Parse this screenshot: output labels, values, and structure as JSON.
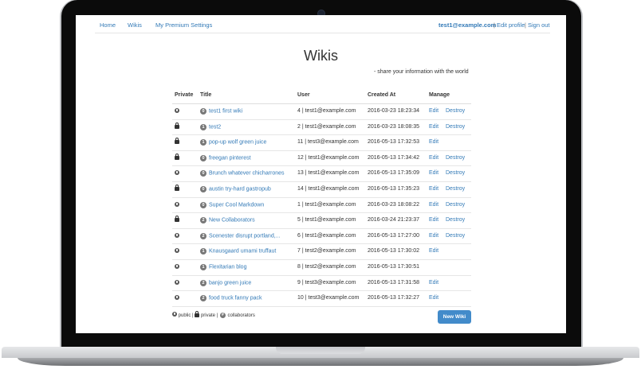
{
  "nav": {
    "home": "Home",
    "wikis": "Wikis",
    "premium": "My Premium Settings",
    "user_email": "test1@example.com",
    "edit_profile": "Edit profile",
    "sign_out": "Sign out",
    "separator": "|"
  },
  "page": {
    "title": "Wikis",
    "tagline": "- share your information with the world"
  },
  "table": {
    "headers": {
      "private": "Private",
      "title": "Title",
      "user": "User",
      "created": "Created At",
      "manage": "Manage"
    },
    "edit_label": "Edit",
    "destroy_label": "Destroy",
    "rows": [
      {
        "privacy": "public",
        "collaborators": "0",
        "title": "test1 first wiki",
        "user": "4 | test1@example.com",
        "created": "2016-03-23 18:23:34",
        "edit": "Edit",
        "destroy": "Destroy"
      },
      {
        "privacy": "private",
        "collaborators": "1",
        "title": "test2",
        "user": "2 | test1@example.com",
        "created": "2016-03-23 18:08:35",
        "edit": "Edit",
        "destroy": "Destroy"
      },
      {
        "privacy": "private",
        "collaborators": "1",
        "title": "pop-up wolf green juice",
        "user": "11 | test3@example.com",
        "created": "2016-05-13 17:32:53",
        "edit": "Edit",
        "destroy": ""
      },
      {
        "privacy": "private",
        "collaborators": "0",
        "title": "freegan pinterest",
        "user": "12 | test1@example.com",
        "created": "2016-05-13 17:34:42",
        "edit": "Edit",
        "destroy": "Destroy"
      },
      {
        "privacy": "public",
        "collaborators": "0",
        "title": "Brunch whatever chicharrones",
        "user": "13 | test1@example.com",
        "created": "2016-05-13 17:35:09",
        "edit": "Edit",
        "destroy": "Destroy"
      },
      {
        "privacy": "private",
        "collaborators": "0",
        "title": "austin try-hard gastropub",
        "user": "14 | test1@example.com",
        "created": "2016-05-13 17:35:23",
        "edit": "Edit",
        "destroy": "Destroy"
      },
      {
        "privacy": "public",
        "collaborators": "0",
        "title": "Super Cool Markdown",
        "user": "1 | test1@example.com",
        "created": "2016-03-23 18:08:22",
        "edit": "Edit",
        "destroy": "Destroy"
      },
      {
        "privacy": "private",
        "collaborators": "2",
        "title": "New Collaborators",
        "user": "5 | test1@example.com",
        "created": "2016-03-24 21:23:37",
        "edit": "Edit",
        "destroy": "Destroy"
      },
      {
        "privacy": "public",
        "collaborators": "2",
        "title": "Scenester disrupt portland,...",
        "user": "6 | test1@example.com",
        "created": "2016-05-13 17:27:00",
        "edit": "Edit",
        "destroy": "Destroy"
      },
      {
        "privacy": "public",
        "collaborators": "1",
        "title": "Knausgaard umami truffaut",
        "user": "7 | test2@example.com",
        "created": "2016-05-13 17:30:02",
        "edit": "Edit",
        "destroy": ""
      },
      {
        "privacy": "public",
        "collaborators": "1",
        "title": "Flexitarian blog",
        "user": "8 | test2@example.com",
        "created": "2016-05-13 17:30:51",
        "edit": "",
        "destroy": ""
      },
      {
        "privacy": "public",
        "collaborators": "2",
        "title": "banjo green juice",
        "user": "9 | test3@example.com",
        "created": "2016-05-13 17:31:58",
        "edit": "Edit",
        "destroy": ""
      },
      {
        "privacy": "public",
        "collaborators": "2",
        "title": "food truck fanny pack",
        "user": "10 | test3@example.com",
        "created": "2016-05-13 17:32:27",
        "edit": "Edit",
        "destroy": ""
      }
    ]
  },
  "legend": {
    "public": "public",
    "private": "private",
    "collaborators": "collaborators",
    "badge_sample": "#",
    "separator": "|"
  },
  "buttons": {
    "new_wiki": "New Wiki"
  },
  "icons": {
    "public": "globe-icon",
    "private": "lock-icon"
  },
  "colors": {
    "link": "#337ab7",
    "primary_button": "#428bca",
    "badge": "#777777"
  }
}
